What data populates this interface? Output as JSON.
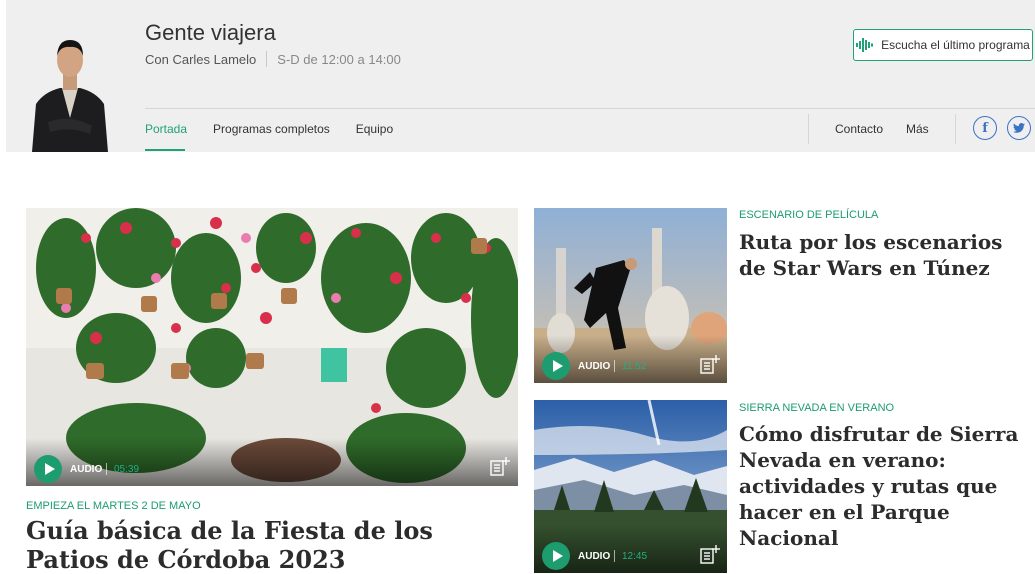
{
  "header": {
    "show_title": "Gente viajera",
    "host": "Con Carles Lamelo",
    "schedule": "S-D de 12:00 a 14:00",
    "listen_button": "Escucha el último programa",
    "nav": [
      "Portada",
      "Programas completos",
      "Equipo"
    ],
    "nav_active": "Portada",
    "contact": "Contacto",
    "more": "Más",
    "social": [
      "facebook-icon",
      "twitter-icon"
    ]
  },
  "articles": [
    {
      "kicker": "Empieza el martes 2 de mayo",
      "headline": "Guía básica de la Fiesta de los Patios de Córdoba 2023",
      "audio_label": "AUDIO",
      "duration": "05:39"
    },
    {
      "kicker": "Escenario de película",
      "headline": "Ruta por los escenarios de Star Wars en Túnez",
      "audio_label": "AUDIO",
      "duration": "11:52"
    },
    {
      "kicker": "Sierra Nevada en verano",
      "headline": "Cómo disfrutar de Sierra Nevada en verano: actividades y rutas que hacer en el Parque Nacional",
      "audio_label": "AUDIO",
      "duration": "12:45"
    }
  ],
  "colors": {
    "accent": "#1c9c6f",
    "header_bg": "#efefef",
    "social": "#3b73c4"
  }
}
